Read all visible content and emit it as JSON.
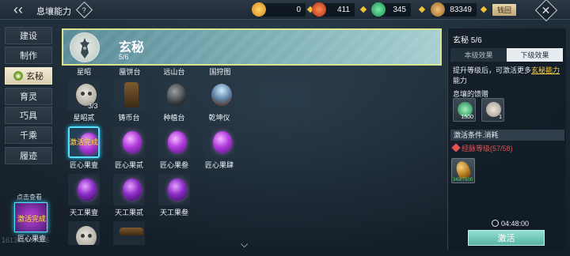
{
  "header": {
    "title": "息壤能力",
    "help_icon": "?",
    "currencies": [
      {
        "icon": "gold-coin-icon",
        "value": "0",
        "color": "#f0a52a"
      },
      {
        "icon": "red-spiral-icon",
        "value": "411",
        "color": "#e0552a"
      },
      {
        "icon": "jade-icon",
        "value": "345",
        "color": "#2fbf73"
      },
      {
        "icon": "bronze-coin-icon",
        "value": "83349",
        "color": "#c4903a"
      }
    ],
    "exchange_label": "钱回"
  },
  "sidebar": {
    "items": [
      {
        "label": "建设",
        "active": false
      },
      {
        "label": "制作",
        "active": false
      },
      {
        "label": "玄秘",
        "active": true
      },
      {
        "label": "育灵",
        "active": false
      },
      {
        "label": "巧具",
        "active": false
      },
      {
        "label": "千乘",
        "active": false
      },
      {
        "label": "履迹",
        "active": false
      }
    ],
    "click_view": "点击查看",
    "badge_status": "激活完成",
    "badge_label": "匠心果壹",
    "faint_id": "161301003826"
  },
  "banner": {
    "name": "玄秘",
    "level": "5/6"
  },
  "grid": {
    "column_headers": [
      "星昭",
      "蜃饼台",
      "远山台",
      "国狩图"
    ],
    "items": [
      {
        "label": "星昭贰",
        "count": "3/3",
        "kind": "face"
      },
      {
        "label": "铸币台",
        "count": "",
        "kind": "statue"
      },
      {
        "label": "种植台",
        "count": "",
        "kind": "urn"
      },
      {
        "label": "乾坤仪",
        "count": "",
        "kind": "orb"
      },
      {
        "label": "匠心果壹",
        "count": "",
        "kind": "gem",
        "status": "激活完成",
        "selected": true
      },
      {
        "label": "匠心果贰",
        "count": "",
        "kind": "gem"
      },
      {
        "label": "匠心果叁",
        "count": "",
        "kind": "gem"
      },
      {
        "label": "匠心果肆",
        "count": "",
        "kind": "gem"
      },
      {
        "label": "天工果壹",
        "count": "",
        "kind": "gem-dark"
      },
      {
        "label": "天工果贰",
        "count": "",
        "kind": "gem-dark"
      },
      {
        "label": "天工果叁",
        "count": "",
        "kind": "gem-dark"
      }
    ]
  },
  "right_panel": {
    "title": "玄秘 5/6",
    "tab_current": "本级效果",
    "tab_next": "下级效果",
    "desc_prefix": "提升等级后，可激活更多",
    "desc_highlight": "玄秘能力",
    "desc_suffix": "能力",
    "gift_heading": "息壤的馈赠",
    "gifts": [
      {
        "icon": "green-gem-icon",
        "count": "1500"
      },
      {
        "icon": "mask-icon",
        "count": "1"
      }
    ],
    "condition_heading": "激活条件.消耗",
    "requirement": "经脉等级(57/58)",
    "material_count": "349/7500",
    "timer": "04:48:00",
    "activate_label": "激活"
  }
}
